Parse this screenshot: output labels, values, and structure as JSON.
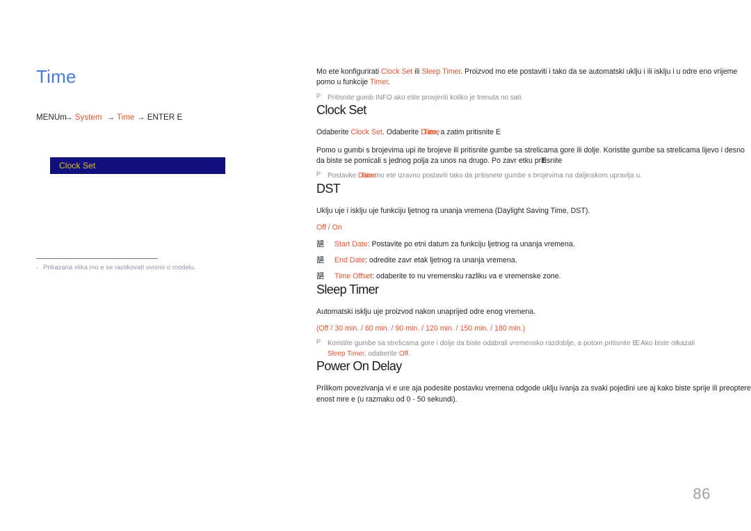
{
  "page": {
    "number": "86",
    "title": "Time"
  },
  "breadcrumb": {
    "menu_label": "MENU",
    "menu_glyph": "m",
    "glyph_arrow": "→",
    "item1": "System",
    "arrow1": "→",
    "item2": "Time",
    "arrow2": "→",
    "enter_label": "ENTER",
    "enter_glyph": "E"
  },
  "osd": {
    "clock_set": "Clock Set"
  },
  "left_footnote": {
    "dash": "-",
    "text": "Prikazana slika mo e se razlikovati ovisno o modelu."
  },
  "intro": {
    "part1": "Mo ete konfigurirati ",
    "link1": "Clock Set",
    "part2": " ili ",
    "link2": "Sleep Timer",
    "part3": ". Proizvod mo ete postaviti i tako da se automatski uklju i ili isklju i u odre eno vrijeme pomo u funkcije ",
    "link3": "Timer",
    "part4": ".",
    "note_mark": "P",
    "note": "Pritisnite gumb INFO ako  elite provjeriti koliko je trenuta no sati."
  },
  "clock_set": {
    "heading": "Clock Set",
    "line1_a": "Odaberite ",
    "line1_link1": "Clock Set",
    "line1_b": ". Odaberite ",
    "line1_overlap_a": "Date",
    "line1_overlap_b": "Time",
    "line1_c": ", a zatim pritisnite ",
    "line1_enter": "E",
    "para_a": "Pomo u gumbi s brojevima upi ite brojeve ili pritisnite gumbe sa strelicama gore ili dolje. Koristite gumbe sa strelicama lijevo i desno da biste se pomicali s jednog polja za unos na drugo. Po zavr etku p",
    "para_overlap_a": "ritisnite",
    "para_overlap_b": "E",
    "note_mark": "P",
    "note_a": "Postavke ",
    "note_overlap_a": "Date",
    "note_overlap_b": "Time",
    "note_b": " mo ete izravno postaviti tako da pritisnete gumbe s brojevima na daljinskom upravlja u."
  },
  "dst": {
    "heading": "DST",
    "description": "Uklju uje i isklju uje funkciju ljetnog ra unanja vremena (Daylight Saving Time, DST).",
    "options": [
      "Off",
      "On"
    ],
    "options_separator": " / ",
    "bullet_glyph": "郶",
    "bullets": [
      {
        "label": "Start Date",
        "text": ": Postavite po etni datum za funkciju ljetnog ra unanja vremena."
      },
      {
        "label": "End Date",
        "text": ": odredite zavr etak ljetnog ra unanja vremena."
      },
      {
        "label": "Time Offset",
        "text": ": odaberite to nu vremensku razliku va e vremenske zone."
      }
    ]
  },
  "sleep_timer": {
    "heading": "Sleep Timer",
    "description": "Automatski isklju uje proizvod nakon unaprijed odre enog vremena.",
    "options_open": "(",
    "options": [
      "Off",
      "30 min.",
      "60 min.",
      "90 min.",
      "120 min.",
      "150 min.",
      "180 min."
    ],
    "options_separator": " / ",
    "options_close": ")",
    "note_mark": "P",
    "note_a": "Koristite gumbe sa strelicama gore i dolje da biste odabrali vremensko razdoblje, a potom pritisnite ",
    "note_overlap_a": "E. Ako biste",
    "note_overlap_b": "E",
    "note_b": " otkazali ",
    "note_link": "Sleep Timer",
    "note_c": ", odaberite ",
    "note_link2": "Off",
    "note_d": "."
  },
  "power_on_delay": {
    "heading": "Power On Delay",
    "description": "Prilikom povezivanja vi e ure aja podesite postavku vremena odgode uklju ivanja za svaki pojedini ure aj kako biste sprije ili preoptere enost mre e (u razmaku od 0 - 50 sekundi)."
  },
  "colors": {
    "accent_red": "#e8502c",
    "title_blue": "#4a7ddb",
    "osd_bg": "#10117e",
    "osd_text": "#e8c020",
    "note_grey": "#8a8a8a",
    "footnote_grey": "#8f97a6",
    "page_number_grey": "#a0a0a0"
  }
}
